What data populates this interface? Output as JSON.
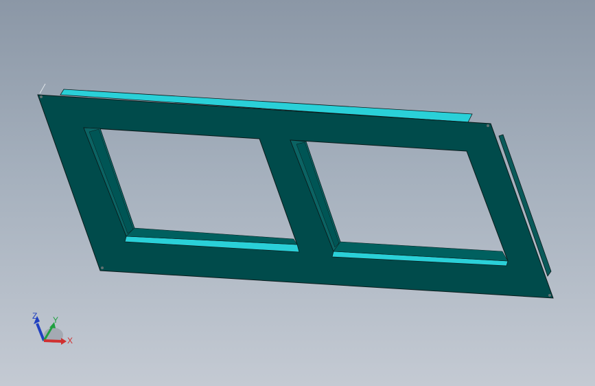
{
  "viewport": {
    "background_top": "#8b97a6",
    "background_bottom": "#c4cad3"
  },
  "model": {
    "face_color": "#004b4b",
    "flange_color": "#2ad0d8",
    "edge_color": "#0a1a1a"
  },
  "triad": {
    "icon": "axis-triad-icon",
    "x_label": "X",
    "y_label": "Y",
    "z_label": "Z",
    "x_color": "#d03030",
    "y_color": "#20a040",
    "z_color": "#2040c0"
  }
}
